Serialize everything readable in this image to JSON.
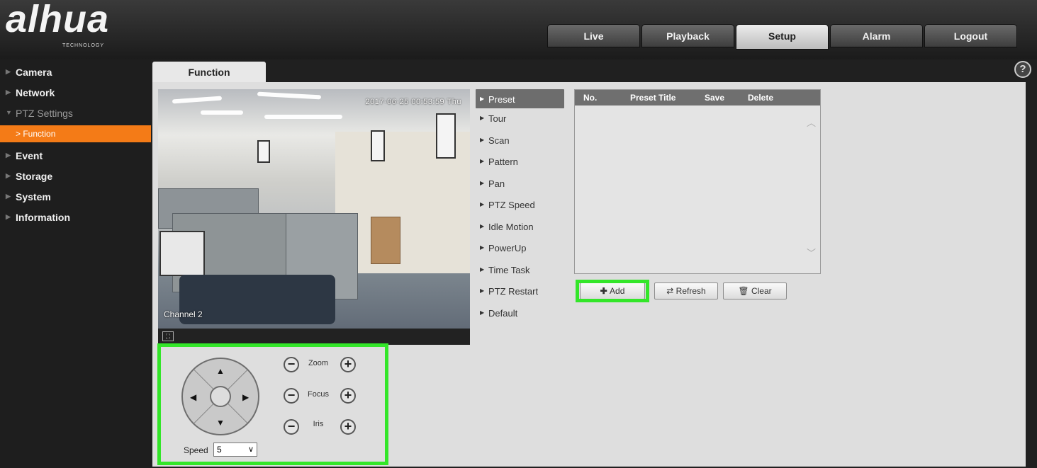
{
  "brand": {
    "logo": "alhua",
    "tagline": "TECHNOLOGY"
  },
  "top_tabs": [
    {
      "label": "Live"
    },
    {
      "label": "Playback"
    },
    {
      "label": "Setup",
      "active": true
    },
    {
      "label": "Alarm"
    },
    {
      "label": "Logout"
    }
  ],
  "sidebar": {
    "items": [
      {
        "label": "Camera"
      },
      {
        "label": "Network"
      },
      {
        "label": "PTZ Settings",
        "expanded": true
      },
      {
        "label": "> Function",
        "selected": true
      },
      {
        "label": "Event"
      },
      {
        "label": "Storage"
      },
      {
        "label": "System"
      },
      {
        "label": "Information"
      }
    ]
  },
  "content": {
    "tab": "Function",
    "help": "?"
  },
  "video": {
    "timestamp": "2017-06-25 00:53:59 Thu",
    "channel": "Channel 2"
  },
  "function_menu": [
    {
      "label": "Preset",
      "active": true
    },
    {
      "label": "Tour"
    },
    {
      "label": "Scan"
    },
    {
      "label": "Pattern"
    },
    {
      "label": "Pan"
    },
    {
      "label": "PTZ Speed"
    },
    {
      "label": "Idle Motion"
    },
    {
      "label": "PowerUp"
    },
    {
      "label": "Time Task"
    },
    {
      "label": "PTZ Restart"
    },
    {
      "label": "Default"
    }
  ],
  "preset_table": {
    "headers": [
      "No.",
      "Preset Title",
      "Save",
      "Delete"
    ],
    "rows": []
  },
  "actions": {
    "add": "Add",
    "refresh": "Refresh",
    "clear": "Clear"
  },
  "ptz": {
    "zoom": "Zoom",
    "focus": "Focus",
    "iris": "Iris",
    "speed_label": "Speed",
    "speed_value": "5"
  },
  "colors": {
    "accent": "#f47b17",
    "highlight": "#33e629"
  }
}
